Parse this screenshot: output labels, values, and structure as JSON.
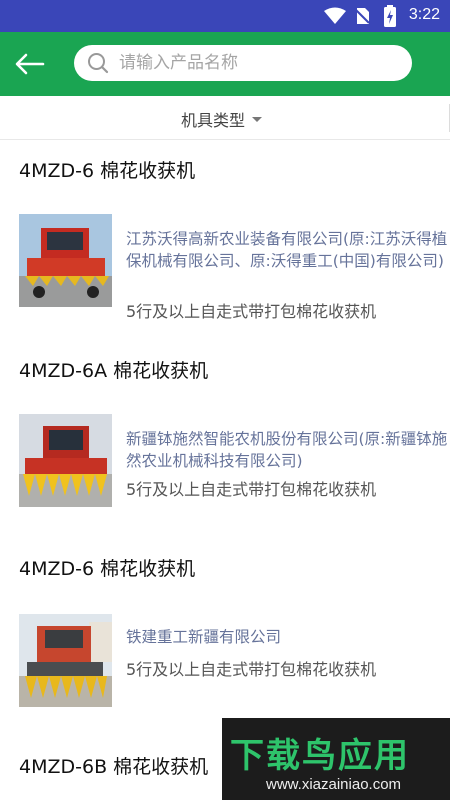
{
  "status_bar": {
    "time": "3:22"
  },
  "header": {
    "back_icon": "arrow-left-icon",
    "search": {
      "placeholder": "请输入产品名称",
      "value": ""
    }
  },
  "filter": {
    "label": "机具类型"
  },
  "products": [
    {
      "title": "4MZD-6 棉花收获机",
      "company": "江苏沃得高新农业装备有限公司(原:江苏沃得植保机械有限公司、原:沃得重工(中国)有限公司)",
      "category": "5行及以上自走式带打包棉花收获机",
      "image": "red-cotton-harvester"
    },
    {
      "title": "4MZD-6A 棉花收获机",
      "company": "新疆钵施然智能农机股份有限公司(原:新疆钵施然农业机械科技有限公司)",
      "category": "5行及以上自走式带打包棉花收获机",
      "image": "red-yellow-cotton-harvester"
    },
    {
      "title": "4MZD-6 棉花收获机",
      "company": "铁建重工新疆有限公司",
      "category": "5行及以上自走式带打包棉花收获机",
      "image": "red-cotton-harvester-outdoor"
    },
    {
      "title": "4MZD-6B 棉花收获机",
      "company": "",
      "category": "",
      "image": ""
    }
  ],
  "watermark": {
    "brand": "下载鸟应用",
    "url": "www.xiazainiao.com"
  },
  "colors": {
    "status_bar": "#3a46b8",
    "app_bar": "#1aa552",
    "company_text": "#66739a"
  }
}
